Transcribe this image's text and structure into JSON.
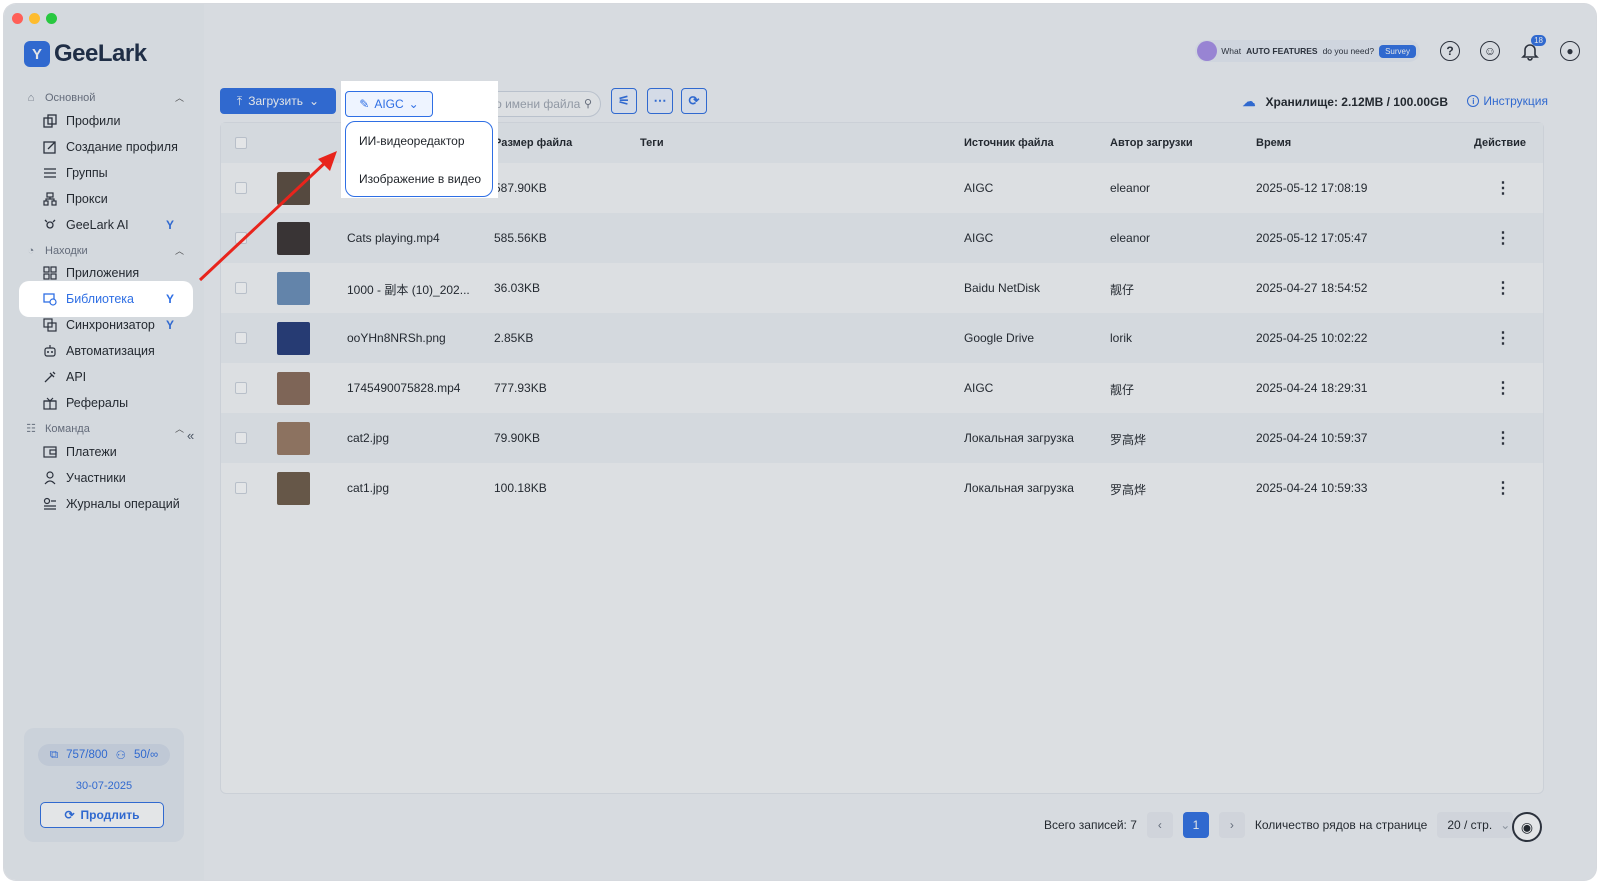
{
  "app": {
    "name": "GeeLark"
  },
  "sidebar": {
    "sections": [
      {
        "label": "Основной"
      },
      {
        "label": "Находки"
      },
      {
        "label": "Команда"
      }
    ],
    "items": [
      {
        "label": "Профили"
      },
      {
        "label": "Создание профиля"
      },
      {
        "label": "Группы"
      },
      {
        "label": "Прокси"
      },
      {
        "label": "GeeLark AI"
      },
      {
        "label": "Приложения"
      },
      {
        "label": "Библиотека"
      },
      {
        "label": "Синхронизатор"
      },
      {
        "label": "Автоматизация"
      },
      {
        "label": "API"
      },
      {
        "label": "Рефералы"
      },
      {
        "label": "Платежи"
      },
      {
        "label": "Участники"
      },
      {
        "label": "Журналы операций"
      }
    ],
    "plan": {
      "profiles": "757/800",
      "members": "50/∞",
      "date": "30-07-2025",
      "renew_label": "Продлить"
    }
  },
  "topbar": {
    "survey_prefix": "What",
    "survey_bold": "AUTO FEATURES",
    "survey_suffix": "do you need?",
    "survey_button": "Survey",
    "notification_count": "18"
  },
  "toolbar": {
    "upload_label": "Загрузить",
    "aigc_label": "AIGC",
    "aigc_menu": [
      "ИИ-видеоредактор",
      "Изображение в видео"
    ],
    "search_placeholder": "Поиск по имени файла",
    "storage_label": "Хранилище: 2.12MB / 100.00GB",
    "instructions_label": "Инструкция"
  },
  "table": {
    "columns": {
      "size": "Размер файла",
      "tags": "Теги",
      "source": "Источник файла",
      "author": "Автор загрузки",
      "time": "Время",
      "action": "Действие"
    },
    "rows": [
      {
        "name": "",
        "size": "587.90KB",
        "tags": "",
        "source": "AIGC",
        "author": "eleanor",
        "time": "2025-05-12 17:08:19",
        "thumb": "#5a4a3c"
      },
      {
        "name": "Cats playing.mp4",
        "size": "585.56KB",
        "tags": "",
        "source": "AIGC",
        "author": "eleanor",
        "time": "2025-05-12 17:05:47",
        "thumb": "#3a3230"
      },
      {
        "name": "1000 - 副本 (10)_202...",
        "size": "36.03KB",
        "tags": "",
        "source": "Baidu NetDisk",
        "author": "靓仔",
        "time": "2025-04-27 18:54:52",
        "thumb": "#6a8fb8"
      },
      {
        "name": "ooYHn8NRSh.png",
        "size": "2.85KB",
        "tags": "",
        "source": "Google Drive",
        "author": "lorik",
        "time": "2025-04-25 10:02:22",
        "thumb": "#243a78"
      },
      {
        "name": "1745490075828.mp4",
        "size": "777.93KB",
        "tags": "",
        "source": "AIGC",
        "author": "靓仔",
        "time": "2025-04-24 18:29:31",
        "thumb": "#8a6a58"
      },
      {
        "name": "cat2.jpg",
        "size": "79.90KB",
        "tags": "",
        "source": "Локальная загрузка",
        "author": "罗高烨",
        "time": "2025-04-24 10:59:37",
        "thumb": "#9a7a62"
      },
      {
        "name": "cat1.jpg",
        "size": "100.18KB",
        "tags": "",
        "source": "Локальная загрузка",
        "author": "罗高烨",
        "time": "2025-04-24 10:59:33",
        "thumb": "#6e5a46"
      }
    ]
  },
  "footer": {
    "total_label": "Всего записей: 7",
    "current_page": "1",
    "rows_per_page_label": "Количество рядов на странице",
    "page_size": "20 / стр."
  },
  "colors": {
    "accent": "#2f6fe4",
    "annotation_arrow": "#e8241c"
  }
}
